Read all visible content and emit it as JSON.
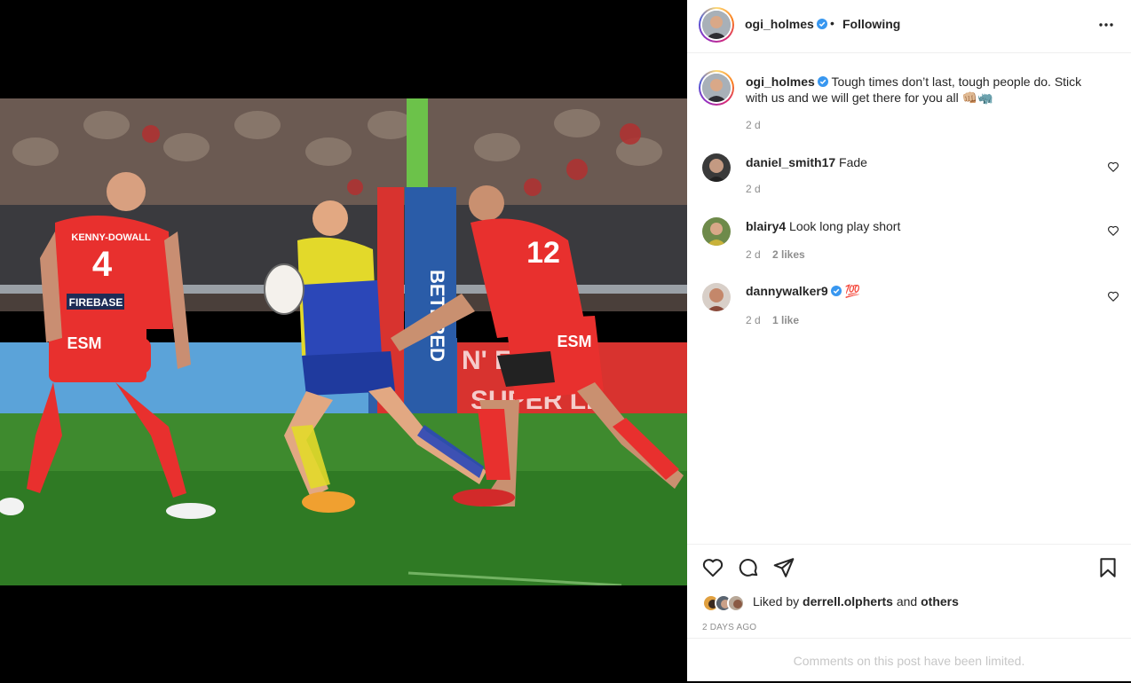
{
  "post": {
    "author": "ogi_holmes",
    "separator": "•",
    "follow_state": "Following",
    "caption_user": "ogi_holmes",
    "caption_text": "Tough times don’t last, tough people do. Stick with us and we will get there for you all 👊🏼🦏",
    "caption_time": "2 d"
  },
  "comments": [
    {
      "user": "daniel_smith17",
      "text": "Fade",
      "time": "2 d",
      "likes": "",
      "verified": false
    },
    {
      "user": "blairy4",
      "text": "Look long play short",
      "time": "2 d",
      "likes": "2 likes",
      "verified": false
    },
    {
      "user": "dannywalker9",
      "text": "💯",
      "time": "2 d",
      "likes": "1 like",
      "verified": true
    }
  ],
  "actions": {
    "liked_prefix": "Liked by",
    "liked_user": "derrell.olpherts",
    "liked_and": "and",
    "liked_others": "others",
    "posted_ago": "2 DAYS AGO",
    "comments_limited": "Comments on this post have been limited."
  },
  "photo": {
    "jersey_number_left": "4",
    "jersey_name_left": "KENNY-DOWALL",
    "jersey_number_right": "12",
    "sponsor_left": "ESM",
    "sponsor_right": "ESM",
    "chest_sponsor": "FIREBASE",
    "banner_text": "BETFRED",
    "ad_text_1": "N' ESPIR",
    "ad_text_2": "SUPER LE"
  },
  "colors": {
    "verified_blue": "#3897f0",
    "text_primary": "#262626",
    "text_secondary": "#8e8e8e",
    "divider": "#efefef"
  },
  "icons": [
    "more-icon",
    "verified-icon",
    "heart-icon",
    "comment-icon",
    "share-icon",
    "bookmark-icon"
  ]
}
